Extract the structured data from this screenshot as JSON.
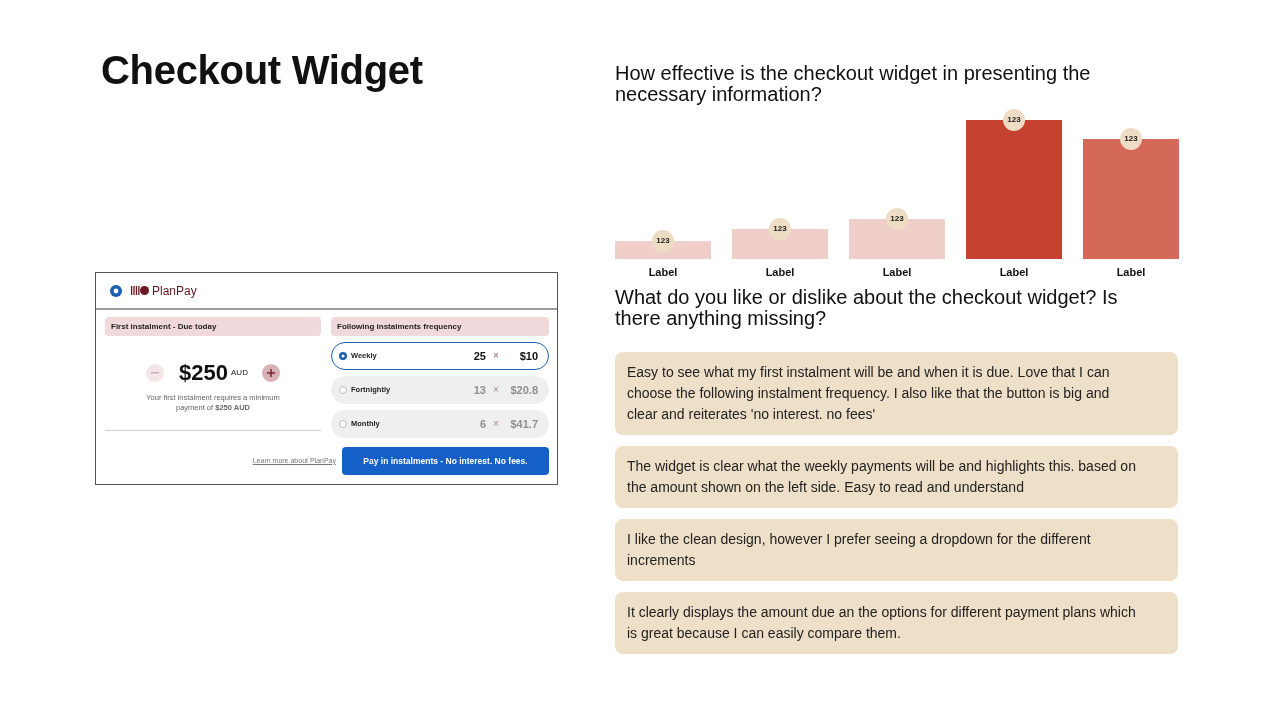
{
  "title": "Checkout Widget",
  "widget": {
    "payment_method": {
      "brand": "PlanPay",
      "selected": true
    },
    "first_instalment": {
      "heading": "First instalment - Due today",
      "amount": "$250",
      "currency": "AUD",
      "decrease": {
        "disabled": true
      },
      "increase": {
        "disabled": false
      },
      "note": "Your first instalment requires a minimum payment of **$250 AUD**"
    },
    "frequency": {
      "heading": "Following instalments frequency",
      "options": [
        {
          "label": "Weekly",
          "count": "25",
          "sign": "×",
          "amount": "$10",
          "selected": true
        },
        {
          "label": "Fortnightly",
          "count": "13",
          "sign": "×",
          "amount": "$20.8",
          "selected": false
        },
        {
          "label": "Monthly",
          "count": "6",
          "sign": "×",
          "amount": "$41.7",
          "selected": false
        }
      ]
    },
    "learn_more": "Learn more about PlanPay",
    "pay_button": "Pay in instalments - No interest. No fees."
  },
  "rating_question": {
    "question": "How effective is the checkout widget in presenting the necessary information?",
    "bars": [
      {
        "label": "Label",
        "value_label": "123",
        "color": "#f0cfcb"
      },
      {
        "label": "Label",
        "value_label": "123",
        "color": "#f0cfcb"
      },
      {
        "label": "Label",
        "value_label": "123",
        "color": "#f0cfcb"
      },
      {
        "label": "Label",
        "value_label": "123",
        "color": "#c54130"
      },
      {
        "label": "Label",
        "value_label": "123",
        "color": "#d4695a"
      }
    ]
  },
  "feedback_question": {
    "question": "What do you like or dislike about the checkout widget? Is there anything missing?",
    "comments": [
      "Easy to see what my first instalment will be and when it is due. Love that I can choose the following instalment frequency. I also like that the button is big and clear and reiterates 'no interest. no fees'",
      "The widget is clear what the weekly payments will be and highlights this. based on the amount shown on the left side. Easy to read and understand",
      "I like the clean design, however I prefer seeing a dropdown for the different increments",
      "It clearly displays the amount due an the options for different payment plans which is great because I can easily compare them."
    ]
  }
}
